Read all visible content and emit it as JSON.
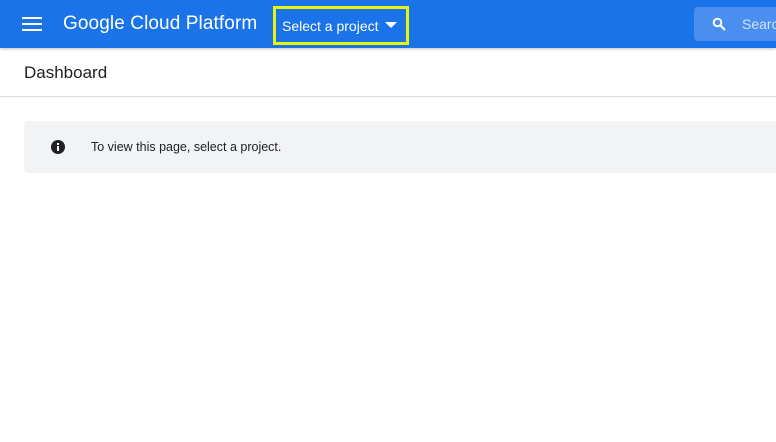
{
  "header": {
    "app_title": "Google Cloud Platform",
    "project_picker_label": "Select a project",
    "search_placeholder": "Search"
  },
  "page": {
    "title": "Dashboard"
  },
  "banner": {
    "message": "To view this page, select a project."
  },
  "colors": {
    "topbar": "#1a73e8",
    "highlight": "#e8f70a",
    "banner_bg": "#f1f3f4"
  },
  "icons": [
    "menu-icon",
    "dropdown-arrow-icon",
    "search-icon",
    "info-icon"
  ]
}
